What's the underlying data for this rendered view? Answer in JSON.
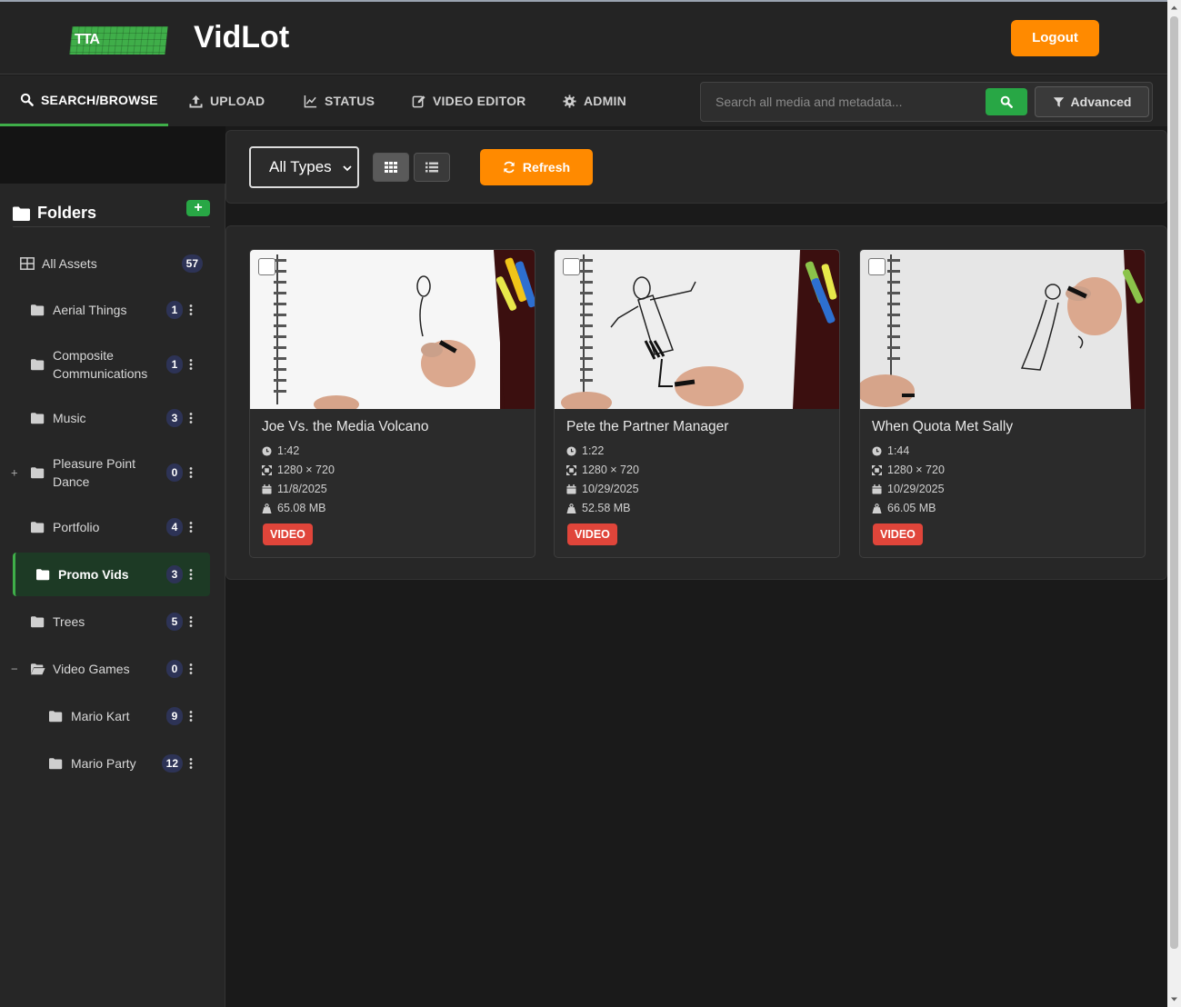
{
  "app": {
    "title": "VidLot",
    "logo_text": "TTA",
    "logout_label": "Logout"
  },
  "nav": {
    "tabs": [
      {
        "label": "SEARCH/BROWSE",
        "icon": "search-icon"
      },
      {
        "label": "UPLOAD",
        "icon": "upload-icon"
      },
      {
        "label": "STATUS",
        "icon": "chart-line-icon"
      },
      {
        "label": "VIDEO EDITOR",
        "icon": "edit-icon"
      },
      {
        "label": "ADMIN",
        "icon": "gear-icon"
      }
    ],
    "search_placeholder": "Search all media and metadata...",
    "advanced_label": "Advanced"
  },
  "sidebar": {
    "title": "Folders",
    "add_label": "+",
    "all_assets": {
      "label": "All Assets",
      "count": "57"
    },
    "folders": [
      {
        "label": "Aerial Things",
        "count": "1"
      },
      {
        "label": "Composite Communications",
        "count": "1"
      },
      {
        "label": "Music",
        "count": "3"
      },
      {
        "label": "Pleasure Point Dance",
        "count": "0",
        "toggle": "+"
      },
      {
        "label": "Portfolio",
        "count": "4"
      },
      {
        "label": "Promo Vids",
        "count": "3",
        "active": true
      },
      {
        "label": "Trees",
        "count": "5"
      },
      {
        "label": "Video Games",
        "count": "0",
        "toggle": "−"
      },
      {
        "label": "Mario Kart",
        "count": "9"
      },
      {
        "label": "Mario Party",
        "count": "12"
      }
    ]
  },
  "toolbar": {
    "type_filter": "All Types",
    "refresh_label": "Refresh"
  },
  "assets": [
    {
      "title": "Joe Vs. the Media Volcano",
      "duration": "1:42",
      "resolution": "1280 × 720",
      "date": "11/8/2025",
      "size": "65.08 MB",
      "type": "VIDEO"
    },
    {
      "title": "Pete the Partner Manager",
      "duration": "1:22",
      "resolution": "1280 × 720",
      "date": "10/29/2025",
      "size": "52.58 MB",
      "type": "VIDEO"
    },
    {
      "title": "When Quota Met Sally",
      "duration": "1:44",
      "resolution": "1280 × 720",
      "date": "10/29/2025",
      "size": "66.05 MB",
      "type": "VIDEO"
    }
  ],
  "colors": {
    "accent_orange": "#ff8a00",
    "accent_green": "#28a745",
    "badge_red": "#e0453a",
    "active_folder_bg": "#1d3a25"
  }
}
